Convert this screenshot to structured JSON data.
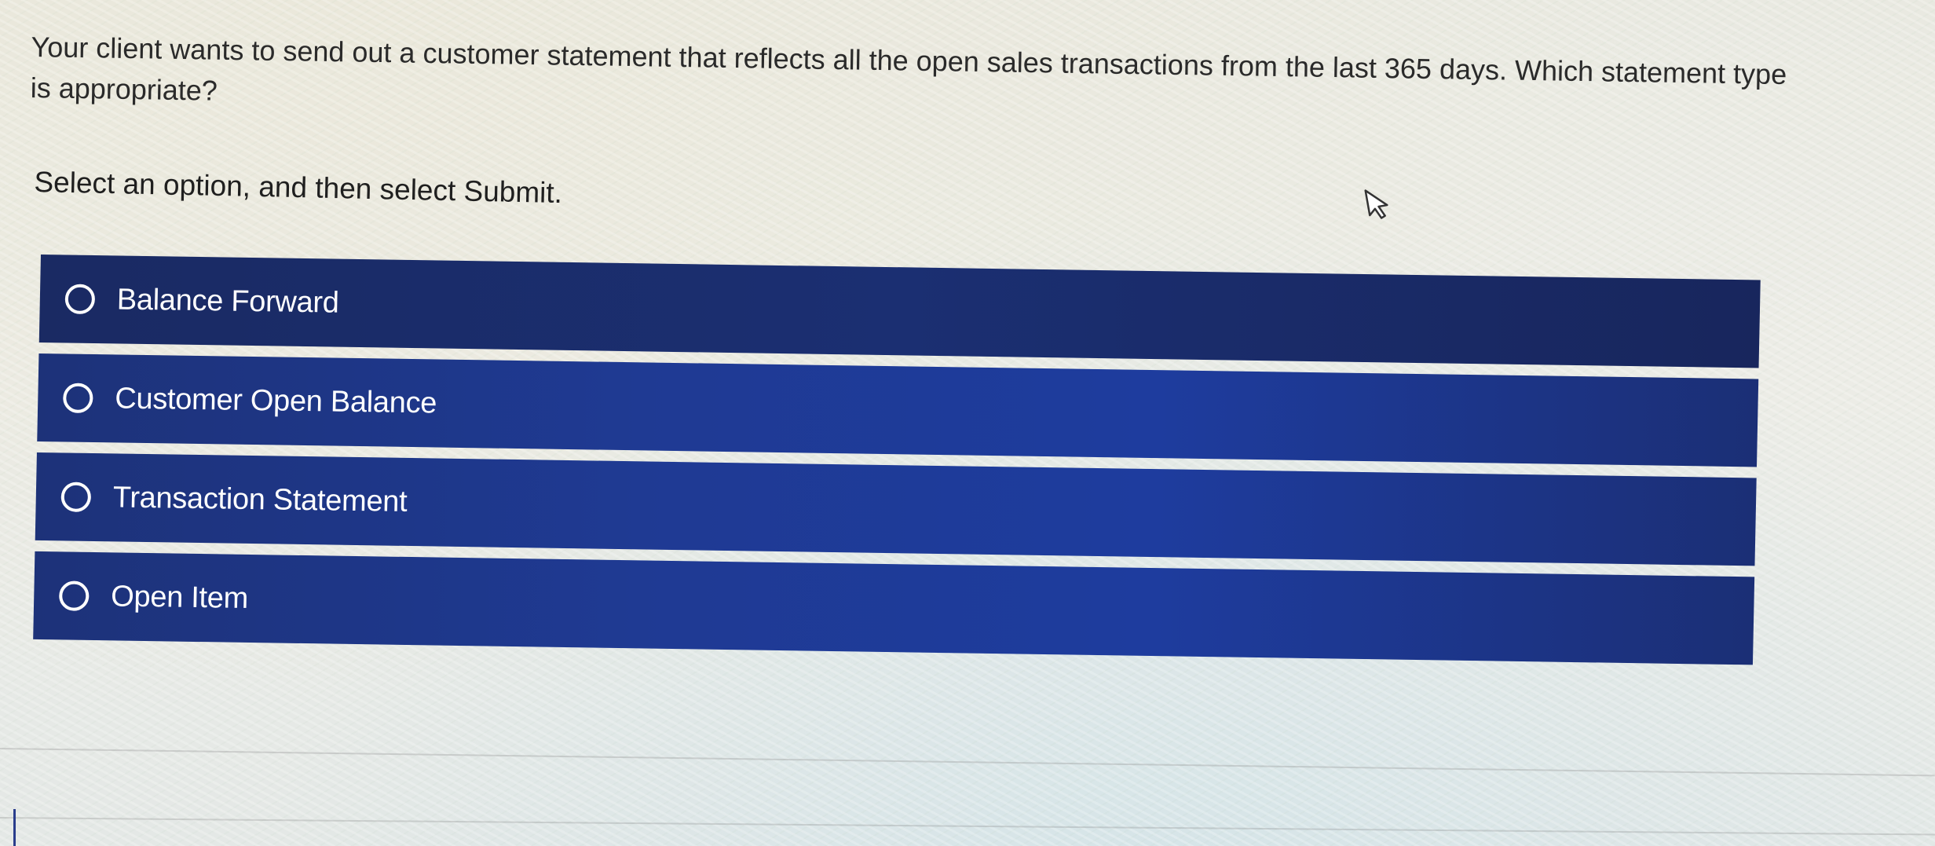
{
  "question": {
    "text": "Your client wants to send out a customer statement that reflects all the open sales transactions from the last 365 days. Which statement type is appropriate?"
  },
  "instruction": {
    "text": "Select an option, and then select Submit."
  },
  "options": [
    {
      "label": "Balance Forward",
      "selected": false
    },
    {
      "label": "Customer Open Balance",
      "selected": false
    },
    {
      "label": "Transaction Statement",
      "selected": false
    },
    {
      "label": "Open Item",
      "selected": false
    }
  ],
  "colors": {
    "option_background": "#1f3a93",
    "option_text": "#ffffff",
    "question_text": "#2a2a2a"
  },
  "icons": {
    "cursor": "pointer-cursor-icon",
    "radio": "radio-unchecked-icon"
  }
}
